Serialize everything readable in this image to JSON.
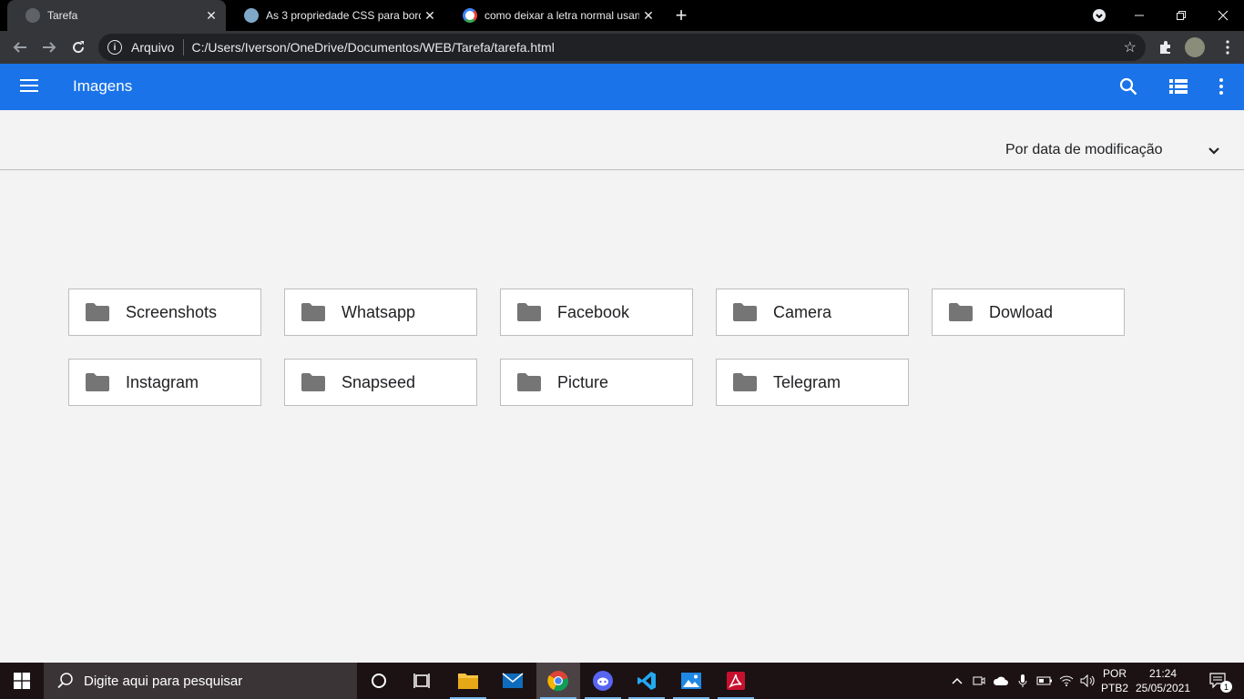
{
  "browser": {
    "tabs": [
      {
        "title": "Tarefa",
        "active": true
      },
      {
        "title": "As 3 propriedade CSS para borda",
        "active": false
      },
      {
        "title": "como deixar a letra normal usand",
        "active": false
      }
    ],
    "new_tab_glyph": "+",
    "address": {
      "scheme_label": "Arquivo",
      "url": "C:/Users/Iverson/OneDrive/Documentos/WEB/Tarefa/tarefa.html"
    }
  },
  "appbar": {
    "title": "Imagens"
  },
  "sort": {
    "label": "Por data de modificação"
  },
  "folders": [
    {
      "name": "Screenshots"
    },
    {
      "name": "Whatsapp"
    },
    {
      "name": "Facebook"
    },
    {
      "name": "Camera"
    },
    {
      "name": "Dowload"
    },
    {
      "name": "Instagram"
    },
    {
      "name": "Snapseed"
    },
    {
      "name": "Picture"
    },
    {
      "name": "Telegram"
    }
  ],
  "taskbar": {
    "search_placeholder": "Digite aqui para pesquisar",
    "lang_top": "POR",
    "lang_bottom": "PTB2",
    "time": "21:24",
    "date": "25/05/2021",
    "notification_count": "1"
  },
  "colors": {
    "appbar": "#1a73e8",
    "background": "#f3f3f3",
    "folder_icon": "#757575"
  }
}
